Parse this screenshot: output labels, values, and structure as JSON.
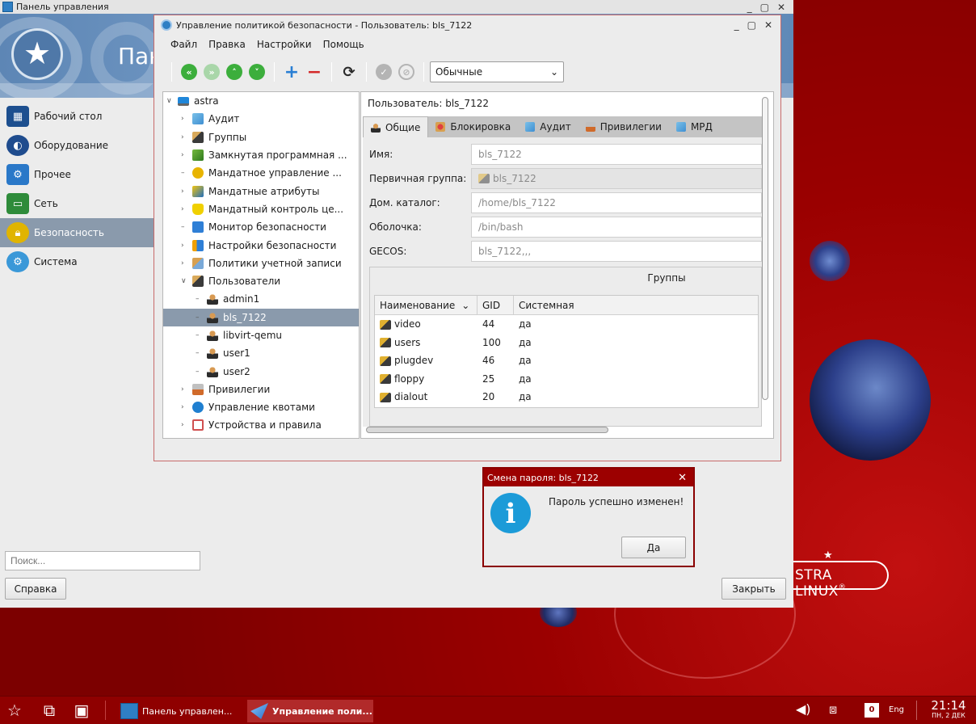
{
  "control_panel": {
    "title": "Панель управления",
    "banner_text": "Пан",
    "nav": [
      {
        "label": "Рабочий стол",
        "icon": "desktop-icon"
      },
      {
        "label": "Оборудование",
        "icon": "hardware-icon"
      },
      {
        "label": "Прочее",
        "icon": "other-icon"
      },
      {
        "label": "Сеть",
        "icon": "network-icon"
      },
      {
        "label": "Безопасность",
        "icon": "security-icon",
        "active": true
      },
      {
        "label": "Система",
        "icon": "system-icon"
      }
    ],
    "search_placeholder": "Поиск...",
    "help_button": "Справка",
    "close_button": "Закрыть"
  },
  "policy_window": {
    "title": "Управление политикой безопасности - Пользователь: bls_7122",
    "menu": [
      "Файл",
      "Правка",
      "Настройки",
      "Помощь"
    ],
    "toolbar": {
      "select_value": "Обычные"
    },
    "tree": [
      {
        "label": "astra",
        "icon": "computer-icon",
        "level": 0,
        "expander": "open"
      },
      {
        "label": "Аудит",
        "icon": "audit-icon",
        "level": 1,
        "expander": "closed"
      },
      {
        "label": "Группы",
        "icon": "groups-icon",
        "level": 1,
        "expander": "closed"
      },
      {
        "label": "Замкнутая программная ...",
        "icon": "closed-env-icon",
        "level": 1,
        "expander": "closed"
      },
      {
        "label": "Мандатное управление ...",
        "icon": "mac-icon",
        "level": 1,
        "expander": "none"
      },
      {
        "label": "Мандатные атрибуты",
        "icon": "mac-attributes-icon",
        "level": 1,
        "expander": "closed"
      },
      {
        "label": "Мандатный контроль це...",
        "icon": "mic-icon",
        "level": 1,
        "expander": "closed"
      },
      {
        "label": "Монитор безопасности",
        "icon": "monitor-icon",
        "level": 1,
        "expander": "none"
      },
      {
        "label": "Настройки безопасности",
        "icon": "settings-icon",
        "level": 1,
        "expander": "closed"
      },
      {
        "label": "Политики учетной записи",
        "icon": "account-policy-icon",
        "level": 1,
        "expander": "closed"
      },
      {
        "label": "Пользователи",
        "icon": "users-icon",
        "level": 1,
        "expander": "open"
      },
      {
        "label": "admin1",
        "icon": "user-icon",
        "level": 2,
        "expander": "none"
      },
      {
        "label": "bls_7122",
        "icon": "user-icon",
        "level": 2,
        "expander": "none",
        "selected": true
      },
      {
        "label": "libvirt-qemu",
        "icon": "user-icon",
        "level": 2,
        "expander": "none"
      },
      {
        "label": "user1",
        "icon": "user-icon",
        "level": 2,
        "expander": "none"
      },
      {
        "label": "user2",
        "icon": "user-icon",
        "level": 2,
        "expander": "none"
      },
      {
        "label": "Привилегии",
        "icon": "privileges-icon",
        "level": 1,
        "expander": "closed"
      },
      {
        "label": "Управление квотами",
        "icon": "quota-icon",
        "level": 1,
        "expander": "closed"
      },
      {
        "label": "Устройства и правила",
        "icon": "devices-icon",
        "level": 1,
        "expander": "closed"
      }
    ],
    "user_header": "Пользователь: bls_7122",
    "tabs": [
      {
        "label": "Общие",
        "active": true
      },
      {
        "label": "Блокировка"
      },
      {
        "label": "Аудит"
      },
      {
        "label": "Привилегии"
      },
      {
        "label": "МРД"
      }
    ],
    "form": {
      "name_label": "Имя:",
      "name_value": "bls_7122",
      "group_label": "Первичная группа:",
      "group_value": "bls_7122",
      "home_label": "Дом. каталог:",
      "home_value": "/home/bls_7122",
      "shell_label": "Оболочка:",
      "shell_value": "/bin/bash",
      "gecos_label": "GECOS:",
      "gecos_value": "bls_7122,,,"
    },
    "groups": {
      "title": "Группы",
      "columns": [
        "Наименование",
        "GID",
        "Системная"
      ],
      "rows": [
        {
          "name": "video",
          "gid": "44",
          "system": "да"
        },
        {
          "name": "users",
          "gid": "100",
          "system": "да"
        },
        {
          "name": "plugdev",
          "gid": "46",
          "system": "да"
        },
        {
          "name": "floppy",
          "gid": "25",
          "system": "да"
        },
        {
          "name": "dialout",
          "gid": "20",
          "system": "да"
        }
      ]
    }
  },
  "dialog": {
    "title": "Смена пароля: bls_7122",
    "message": "Пароль успешно изменен!",
    "ok_button": "Да"
  },
  "desktop": {
    "brand": "STRA LINUX",
    "brand_mark": "®"
  },
  "taskbar": {
    "tasks": [
      {
        "label": "Панель управлен...",
        "active": false
      },
      {
        "label": "Управление поли...",
        "active": true
      }
    ],
    "keyboard_indicator": "0",
    "language": "Eng",
    "time": "21:14",
    "date": "ПН, 2 ДЕК"
  }
}
